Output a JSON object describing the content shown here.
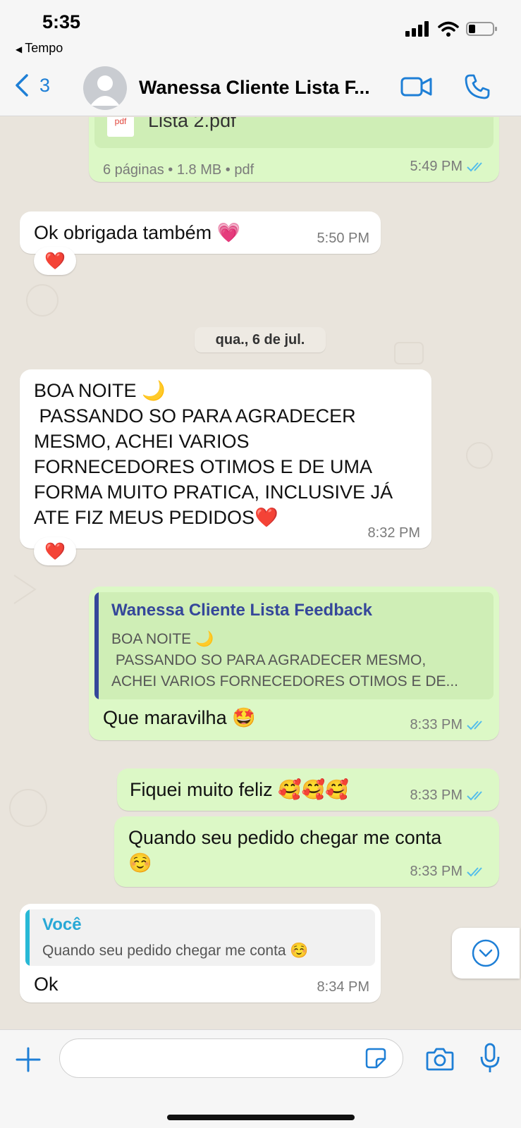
{
  "status_bar": {
    "time": "5:35",
    "back_app": "Tempo"
  },
  "header": {
    "back_count": "3",
    "contact_name": "Wanessa Cliente Lista F...",
    "video_icon": "video-call-icon",
    "call_icon": "phone-icon"
  },
  "messages": [
    {
      "type": "document",
      "direction": "out",
      "doc_icon": "pdf",
      "filename": "Lista 2.pdf",
      "details": "6 páginas • 1.8 MB • pdf",
      "time": "5:49 PM"
    },
    {
      "direction": "in",
      "text": "Ok obrigada também 💗",
      "time": "5:50 PM",
      "reaction": "❤️"
    },
    {
      "direction": "in",
      "lines": [
        "BOA NOITE 🌙",
        " PASSANDO SO PARA AGRADECER",
        "MESMO, ACHEI VARIOS",
        "FORNECEDORES OTIMOS E DE UMA",
        "FORMA MUITO PRATICA, INCLUSIVE JÁ",
        "ATE FIZ MEUS PEDIDOS❤️"
      ],
      "time": "8:32 PM",
      "reaction": "❤️"
    },
    {
      "direction": "out",
      "quote": {
        "author": "Wanessa Cliente Lista Feedback",
        "lines": [
          "BOA NOITE 🌙",
          " PASSANDO SO PARA AGRADECER MESMO,",
          "ACHEI VARIOS FORNECEDORES OTIMOS E DE..."
        ]
      },
      "text": "Que maravilha 🤩",
      "time": "8:33 PM"
    },
    {
      "direction": "out",
      "text": "Fiquei muito feliz 🥰🥰🥰",
      "time": "8:33 PM"
    },
    {
      "direction": "out",
      "lines": [
        "Quando seu pedido chegar me conta",
        "☺️"
      ],
      "time": "8:33 PM"
    },
    {
      "direction": "in",
      "quote": {
        "author": "Você",
        "text": "Quando seu pedido chegar me conta ☺️"
      },
      "text": "Ok",
      "time": "8:34 PM"
    }
  ],
  "date_separator": "qua., 6 de jul.",
  "composer": {
    "placeholder": ""
  },
  "colors": {
    "accent": "#1e7fd6",
    "outgoing": "#dcf8c6",
    "incoming": "#ffffff",
    "read_ticks": "#53bdeb",
    "quote_bar_out": "#35479a",
    "quote_bar_in": "#28b9d6"
  }
}
